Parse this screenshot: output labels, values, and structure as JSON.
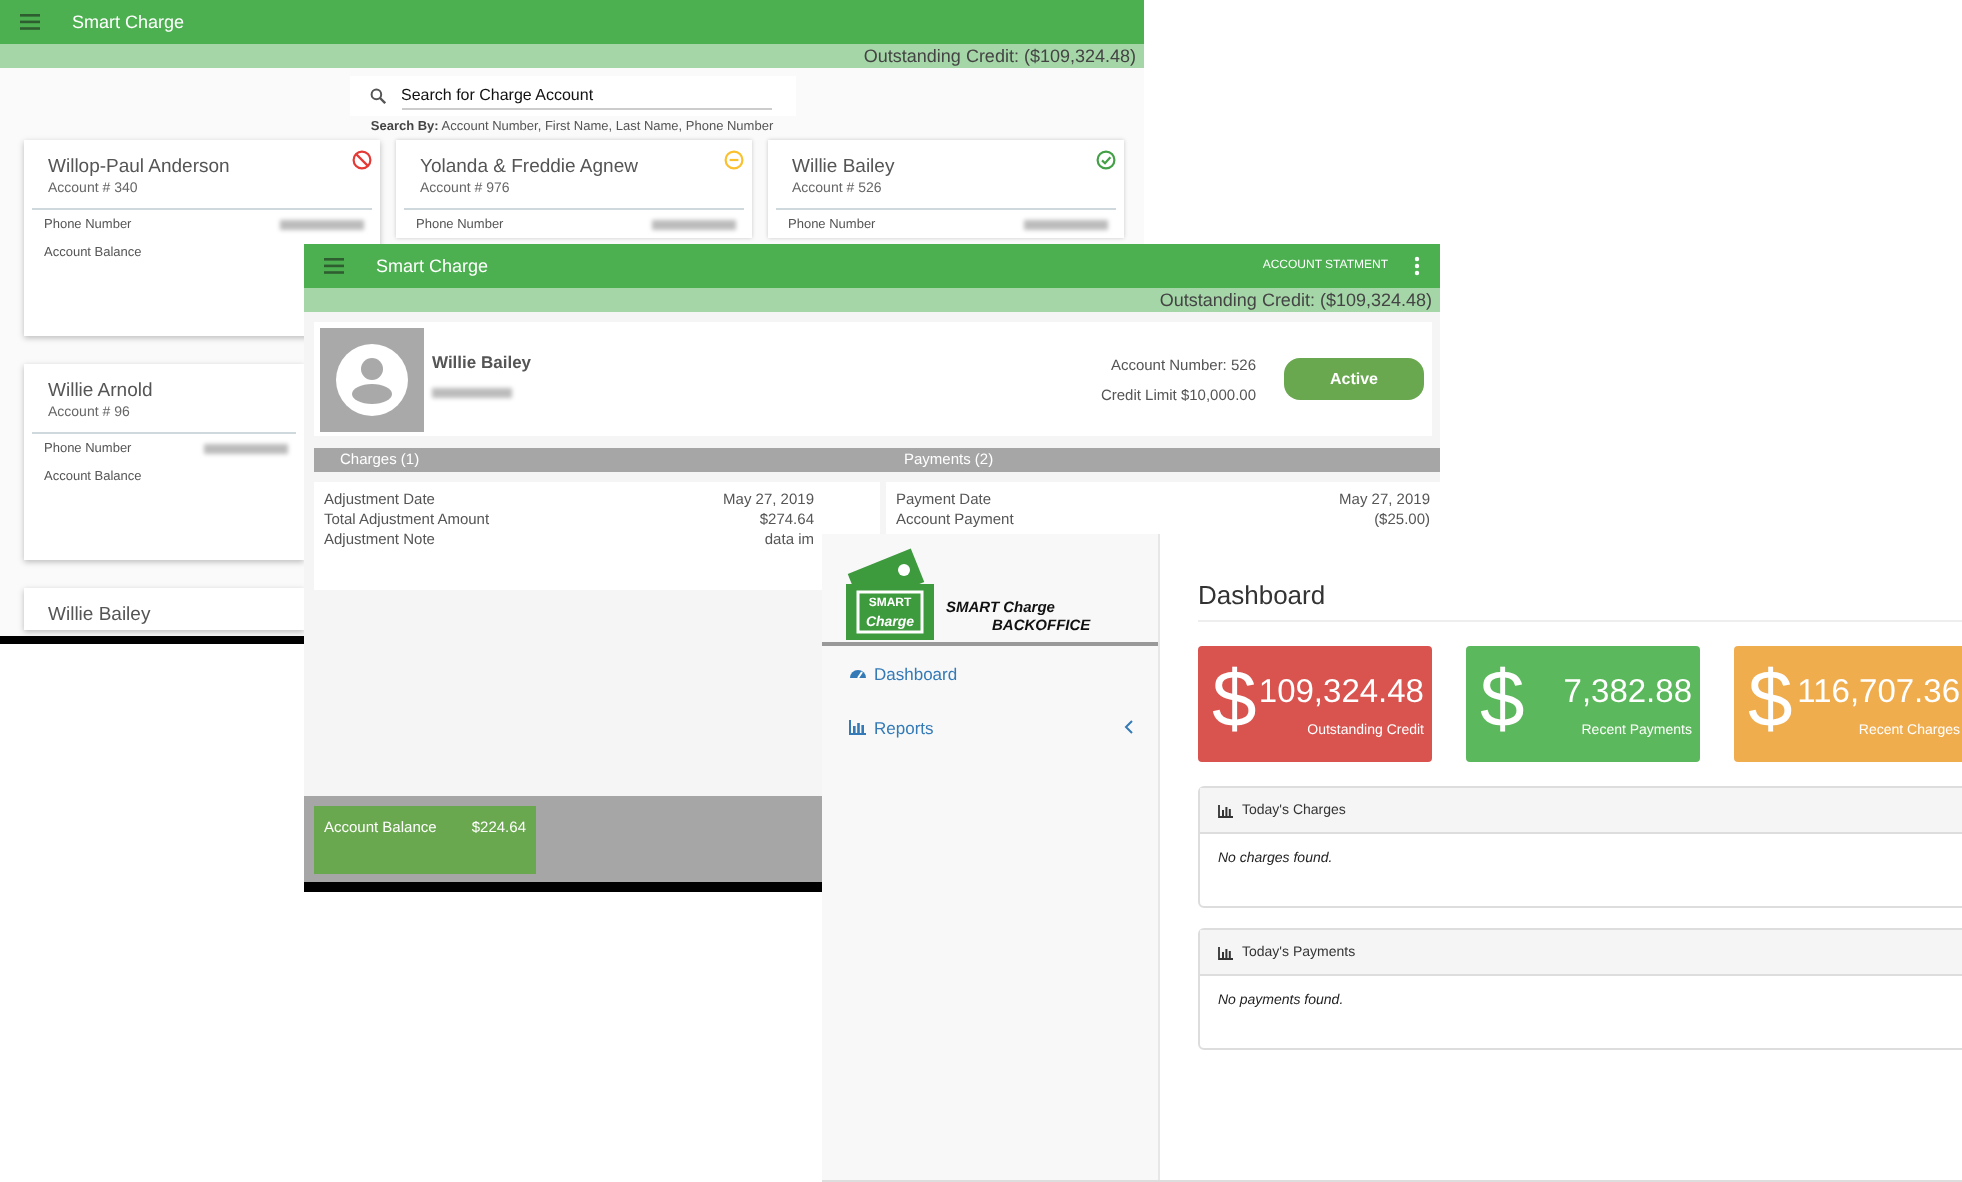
{
  "account_list_window": {
    "title": "Smart Charge",
    "outstanding_credit": "Outstanding Credit: ($109,324.48)",
    "search": {
      "placeholder": "Search for Charge Account"
    },
    "search_by": "**Search By:** Account Number, First Name, Last Name, Phone Number",
    "card_rows": [
      [
        {
          "name": "Willop-Paul Anderson",
          "account": "Account # 340",
          "kind": "blocked",
          "rows": [
            "Phone Number",
            "Account Balance"
          ]
        },
        {
          "name": "Yolanda & Freddie Agnew",
          "account": "Account # 976",
          "kind": "paused",
          "rows": [
            "Phone Number"
          ]
        },
        {
          "name": "Willie Bailey",
          "account": "Account # 526",
          "kind": "approved",
          "rows": [
            "Phone Number"
          ]
        }
      ],
      [
        {
          "name": "Willie Arnold",
          "account": "Account # 96",
          "kind": "plain",
          "rows": [
            "Phone Number",
            "Account Balance"
          ]
        }
      ],
      [
        {
          "name": "Willie Bailey",
          "kind": "plain"
        }
      ]
    ]
  },
  "account_detail_window": {
    "title": "Smart Charge",
    "action": "ACCOUNT STATMENT",
    "outstanding_credit": "Outstanding Credit: ($109,324.48)",
    "customer": {
      "name": "Willie Bailey",
      "account_number": "Account Number: 526",
      "credit_limit": "Credit Limit $10,000.00",
      "status": "Active"
    },
    "sections": [
      {
        "title": "Charges (1)",
        "rows": [
          {
            "label": "Adjustment Date",
            "value": "May 27, 2019"
          },
          {
            "label": "Total Adjustment Amount",
            "value": "$274.64"
          },
          {
            "label": "Adjustment Note",
            "value": "data im"
          }
        ]
      },
      {
        "title": "Payments (2)",
        "rows": [
          {
            "label": "Payment Date",
            "value": "May 27, 2019"
          },
          {
            "label": "Account Payment",
            "value": "($25.00)"
          }
        ]
      }
    ],
    "balance": {
      "label": "Account Balance",
      "value": "$224.64"
    }
  },
  "backoffice_window": {
    "brand": {
      "badge_top": "SMART",
      "badge_text": "Charge",
      "line1": "SMART Charge",
      "line2": "BACKOFFICE"
    },
    "nav": [
      {
        "label": "Dashboard",
        "kind": "dashboard",
        "has_submenu": false
      },
      {
        "label": "Reports",
        "kind": "reports",
        "has_submenu": true
      }
    ],
    "title": "Dashboard",
    "tiles": [
      {
        "symbol": "$",
        "value": "109,324.48",
        "label": "Outstanding Credit",
        "color": "#d9534f"
      },
      {
        "symbol": "$",
        "value": "7,382.88",
        "label": "Recent Payments",
        "color": "#5cb85c"
      },
      {
        "symbol": "$",
        "value": "116,707.36",
        "label": "Recent Charges",
        "color": "#f0ad4e"
      }
    ],
    "panels": [
      {
        "title": "Today's Charges",
        "empty_text": "No charges found."
      },
      {
        "title": "Today's Payments",
        "empty_text": "No payments found."
      }
    ]
  }
}
